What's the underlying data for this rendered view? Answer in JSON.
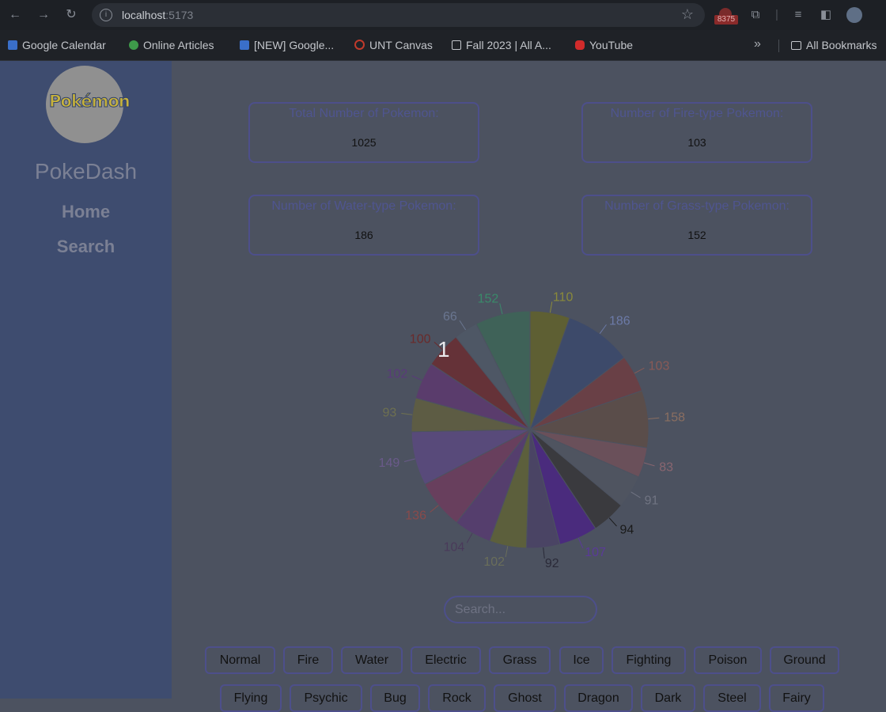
{
  "browser": {
    "url_host": "localhost",
    "url_port": ":5173",
    "extension_badge": "8375",
    "bookmarks": [
      "Google Calendar",
      "Online Articles",
      "[NEW] Google...",
      "UNT Canvas",
      "Fall 2023 | All A...",
      "YouTube"
    ],
    "all_bookmarks": "All Bookmarks"
  },
  "sidebar": {
    "logo_text": "Pokémon",
    "app_title": "PokeDash",
    "nav": [
      "Home",
      "Search"
    ]
  },
  "stats": [
    {
      "label": "Total Number of Pokemon:",
      "value": "1025"
    },
    {
      "label": "Number of Fire-type Pokemon:",
      "value": "103"
    },
    {
      "label": "Number of Water-type Pokemon:",
      "value": "186"
    },
    {
      "label": "Number of Grass-type Pokemon:",
      "value": "152"
    }
  ],
  "chart_data": {
    "type": "pie",
    "values": [
      110,
      186,
      103,
      158,
      83,
      91,
      94,
      107,
      92,
      102,
      104,
      136,
      149,
      93,
      102,
      100,
      66,
      152
    ],
    "colors": [
      "#5e5f33",
      "#3d4a6a",
      "#694046",
      "#5a4d4a",
      "#6a505a",
      "#4f5460",
      "#3a3a3e",
      "#4a2b7d",
      "#4a4464",
      "#5c5f3c",
      "#553e6d",
      "#683f5d",
      "#584a7a",
      "#5d5c44",
      "#5a3c6c",
      "#653238",
      "#4e5765",
      "#3f6258"
    ],
    "label_colors": [
      "#8a8a3a",
      "#6c7aa8",
      "#8a5a56",
      "#8a6e60",
      "#8a6670",
      "#707482",
      "#1a1a1a",
      "#5a3a98",
      "#2a2a38",
      "#6a6e5a",
      "#4a3a5a",
      "#8a4a4a",
      "#6a5a8a",
      "#6e7050",
      "#5a3a7a",
      "#6a2a2a",
      "#6a7690",
      "#3a8a6a"
    ],
    "overlay_label": "1"
  },
  "search": {
    "placeholder": "Search..."
  },
  "types_row1": [
    "Normal",
    "Fire",
    "Water",
    "Electric",
    "Grass",
    "Ice",
    "Fighting",
    "Poison",
    "Ground"
  ],
  "types_row2": [
    "Flying",
    "Psychic",
    "Bug",
    "Rock",
    "Ghost",
    "Dragon",
    "Dark",
    "Steel",
    "Fairy"
  ]
}
